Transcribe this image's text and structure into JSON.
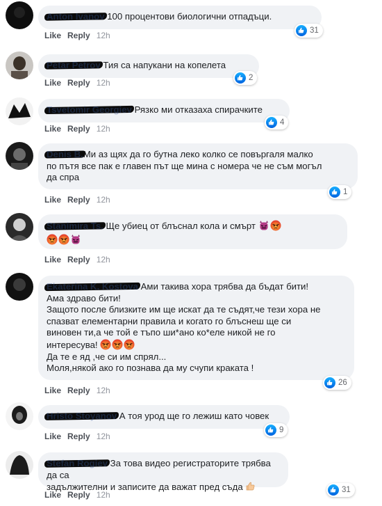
{
  "comments": [
    {
      "author": "Anton Ivanov",
      "text": "100 процентови биологични отпадъци.",
      "reactions": "31",
      "actions": {
        "like": "Like",
        "reply": "Reply",
        "time": "12h"
      }
    },
    {
      "author": "Petar Petrov",
      "text": "Тия са напукани на копелета",
      "reactions": "2",
      "actions": {
        "like": "Like",
        "reply": "Reply",
        "time": "12h"
      }
    },
    {
      "author": "Tsvetomir Georgiev",
      "text": "Рязко ми отказаха спирачките",
      "reactions": "4",
      "actions": {
        "like": "Like",
        "reply": "Reply",
        "time": "12h"
      }
    },
    {
      "author": "Denis B.",
      "text_line1": "Ми аз щях да го бутна леко колко се повъргаля малко",
      "text_rest": "по пътя все пак е главен път ще мина с номера че не съм могъл\nда спра",
      "reactions": "1",
      "actions": {
        "like": "Like",
        "reply": "Reply",
        "time": "12h"
      }
    },
    {
      "author": "Stanimira Ts.",
      "text": "Ще убиец от блъснал кола и смърт",
      "emoji_line1": [
        "devil",
        "angry"
      ],
      "emoji_line2": [
        "angry",
        "angry",
        "devil"
      ],
      "actions": {
        "like": "Like",
        "reply": "Reply",
        "time": "12h"
      }
    },
    {
      "author": "Ekaterina K. Kostova",
      "text_line1": "Ами такива хора трябва да бъдат бити!",
      "text_lines": [
        "Ама здраво бити!",
        "Защото после близките им ще искат да те съдят,че тези хора не",
        "спазват елементарни правила и когато го блъснеш ще си",
        "виновен ти,а че той е тъпо ши*ано ко*еле никой не го",
        "интересува!"
      ],
      "emoji_row": [
        "angry",
        "angry",
        "angry"
      ],
      "text_tail": [
        "Да те е яд ,че си им спрял...",
        "Моля,някой ако го познава да му счупи краката !"
      ],
      "reactions": "26",
      "actions": {
        "like": "Like",
        "reply": "Reply",
        "time": "12h"
      }
    },
    {
      "author": "Hristo Stoyanov",
      "text": "А тоя урод ще го лежиш като човек",
      "reactions": "9",
      "actions": {
        "like": "Like",
        "reply": "Reply",
        "time": "12h"
      }
    },
    {
      "author": "Stefan Rogiev",
      "text_line1": "За това видео регистраторите трябва да са",
      "text_line2": "задължителни и записите да важат пред съда",
      "reactions": "31",
      "actions": {
        "like": "Like",
        "reply": "Reply",
        "time": "12h"
      }
    }
  ],
  "colors": {
    "link": "#385898",
    "bubble": "#f0f2f5",
    "like_blue": "#1877f2",
    "meta": "#65676b"
  }
}
